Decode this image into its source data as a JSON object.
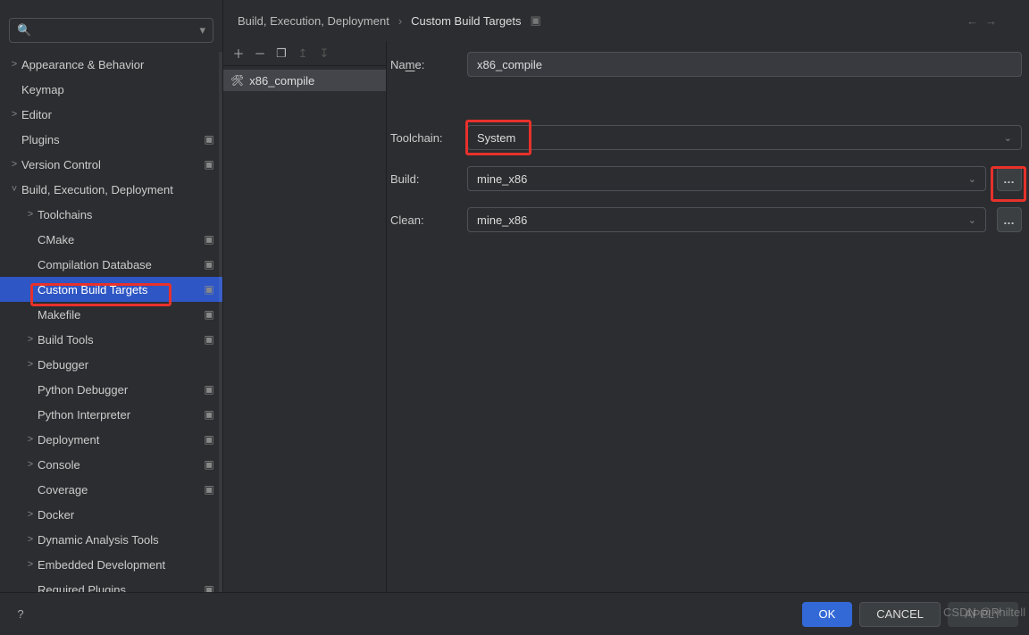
{
  "search": {
    "placeholder": "",
    "icon": "search-icon",
    "caret": "▾"
  },
  "tree": [
    {
      "label": "Appearance & Behavior",
      "indent": 0,
      "chev": ">",
      "icon": ""
    },
    {
      "label": "Keymap",
      "indent": 0,
      "chev": "",
      "icon": ""
    },
    {
      "label": "Editor",
      "indent": 0,
      "chev": ">",
      "icon": ""
    },
    {
      "label": "Plugins",
      "indent": 0,
      "chev": "",
      "icon": "▣"
    },
    {
      "label": "Version Control",
      "indent": 0,
      "chev": ">",
      "icon": "▣"
    },
    {
      "label": "Build, Execution, Deployment",
      "indent": 0,
      "chev": "˅",
      "icon": ""
    },
    {
      "label": "Toolchains",
      "indent": 1,
      "chev": ">",
      "icon": ""
    },
    {
      "label": "CMake",
      "indent": 1,
      "chev": "",
      "icon": "▣"
    },
    {
      "label": "Compilation Database",
      "indent": 1,
      "chev": "",
      "icon": "▣"
    },
    {
      "label": "Custom Build Targets",
      "indent": 1,
      "chev": "",
      "icon": "▣",
      "selected": true
    },
    {
      "label": "Makefile",
      "indent": 1,
      "chev": "",
      "icon": "▣"
    },
    {
      "label": "Build Tools",
      "indent": 1,
      "chev": ">",
      "icon": "▣"
    },
    {
      "label": "Debugger",
      "indent": 1,
      "chev": ">",
      "icon": ""
    },
    {
      "label": "Python Debugger",
      "indent": 1,
      "chev": "",
      "icon": "▣"
    },
    {
      "label": "Python Interpreter",
      "indent": 1,
      "chev": "",
      "icon": "▣"
    },
    {
      "label": "Deployment",
      "indent": 1,
      "chev": ">",
      "icon": "▣"
    },
    {
      "label": "Console",
      "indent": 1,
      "chev": ">",
      "icon": "▣"
    },
    {
      "label": "Coverage",
      "indent": 1,
      "chev": "",
      "icon": "▣"
    },
    {
      "label": "Docker",
      "indent": 1,
      "chev": ">",
      "icon": ""
    },
    {
      "label": "Dynamic Analysis Tools",
      "indent": 1,
      "chev": ">",
      "icon": ""
    },
    {
      "label": "Embedded Development",
      "indent": 1,
      "chev": ">",
      "icon": ""
    },
    {
      "label": "Required Plugins",
      "indent": 1,
      "chev": "",
      "icon": "▣"
    }
  ],
  "breadcrumb": {
    "part1": "Build, Execution, Deployment",
    "sep": "›",
    "part2": "Custom Build Targets",
    "badge": "▣"
  },
  "midToolbar": {
    "add": "＋",
    "remove": "－",
    "copy": "❐",
    "up": "↥",
    "down": "↧"
  },
  "targets": [
    {
      "label": "x86_compile",
      "icon": "🛠"
    }
  ],
  "form": {
    "nameLabel": {
      "pre": "Na",
      "u": "m",
      "post": "e:"
    },
    "nameValue": "x86_compile",
    "toolchainLabel": "Toolchain:",
    "toolchainValue": "System",
    "buildLabel": "Build:",
    "buildValue": "mine_x86",
    "cleanLabel": "Clean:",
    "cleanValue": "mine_x86",
    "ellipsis": "…"
  },
  "buttons": {
    "ok": "OK",
    "cancel": "CANCEL",
    "apply": "APPLY"
  },
  "watermark": "CSDN @Philtell"
}
